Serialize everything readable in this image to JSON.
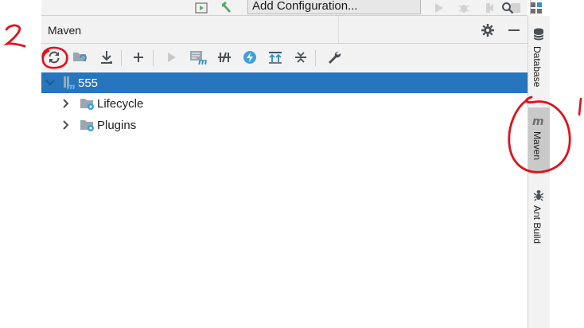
{
  "top_toolbar": {
    "config_label": "Add Configuration..."
  },
  "panel": {
    "title": "Maven"
  },
  "tree": {
    "root": {
      "label": "555"
    },
    "children": [
      {
        "label": "Lifecycle"
      },
      {
        "label": "Plugins"
      }
    ]
  },
  "right_strip": {
    "tabs": [
      {
        "label": "Database",
        "icon": "database-icon"
      },
      {
        "label": "Maven",
        "icon": "maven-m-icon",
        "active": true
      },
      {
        "label": "Ant Build",
        "icon": "ant-icon"
      }
    ]
  },
  "annotations": {
    "left_number": "2",
    "right_number": "1"
  },
  "colors": {
    "selection": "#2675bf",
    "annotation": "#e0101a",
    "refresh_icon": "#4a4f55",
    "run_green": "#59a869",
    "toolbar_bg": "#f2f2f2"
  }
}
